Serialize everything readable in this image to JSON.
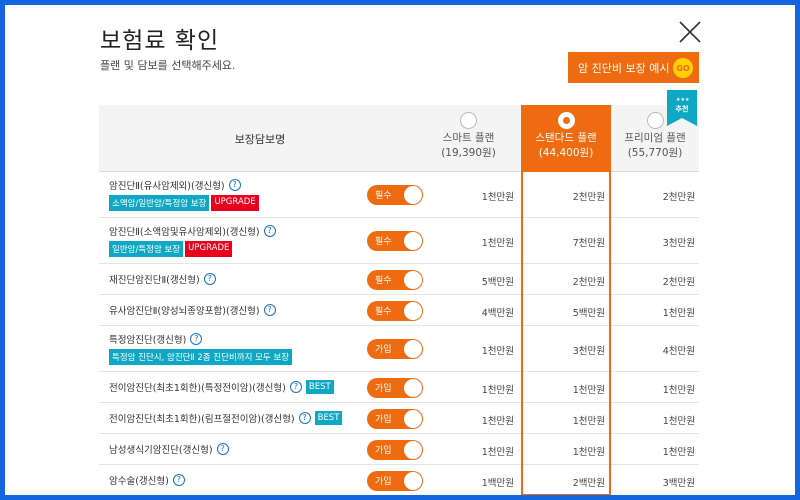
{
  "header": {
    "title": "보험료 확인",
    "subtitle": "플랜 및 담보를 선택해주세요.",
    "promo_label": "암 진단비 보장 예시",
    "promo_go": "GO"
  },
  "table": {
    "name_header": "보장담보명",
    "recommend_badge": "추천",
    "plans": [
      {
        "name": "스마트 플랜",
        "price": "(19,390원)",
        "selected": false
      },
      {
        "name": "스탠다드 플랜",
        "price": "(44,400원)",
        "selected": true
      },
      {
        "name": "프리미엄 플랜",
        "price": "(55,770원)",
        "selected": false
      }
    ],
    "rows": [
      {
        "name": "암진단Ⅱ(유사암제외)(갱신형)",
        "tags": [
          {
            "text": "소액암/일반암/특정암 보장",
            "color": "teal"
          },
          {
            "text": "UPGRADE",
            "color": "red"
          }
        ],
        "best": "",
        "toggle": "필수",
        "amounts": [
          "1천만원",
          "2천만원",
          "2천만원"
        ],
        "height": 46
      },
      {
        "name": "암진단Ⅱ(소액암및유사암제외)(갱신형)",
        "tags": [
          {
            "text": "일반암/특정암 보장",
            "color": "teal"
          },
          {
            "text": "UPGRADE",
            "color": "red"
          }
        ],
        "best": "",
        "toggle": "필수",
        "amounts": [
          "1천만원",
          "7천만원",
          "3천만원"
        ],
        "height": 46
      },
      {
        "name": "재진단암진단Ⅱ(갱신형)",
        "tags": [],
        "best": "",
        "toggle": "필수",
        "amounts": [
          "5백만원",
          "2천만원",
          "2천만원"
        ],
        "height": 31
      },
      {
        "name": "유사암진단Ⅱ(양성뇌종양포함)(갱신형)",
        "tags": [],
        "best": "",
        "toggle": "필수",
        "amounts": [
          "4백만원",
          "5백만원",
          "1천만원"
        ],
        "height": 31
      },
      {
        "name": "특정암진단(갱신형)",
        "tags": [
          {
            "text": "특정암 진단시, 암진단Ⅱ 2종 진단비까지 모두 보장",
            "color": "teal"
          }
        ],
        "best": "",
        "toggle": "가입",
        "amounts": [
          "1천만원",
          "3천만원",
          "4천만원"
        ],
        "height": 46
      },
      {
        "name": "전이암진단(최초1회한)(특정전이암)(갱신형)",
        "tags": [],
        "best": "BEST",
        "toggle": "가입",
        "amounts": [
          "1천만원",
          "1천만원",
          "1천만원"
        ],
        "height": 31
      },
      {
        "name": "전이암진단(최초1회한)(림프절전이암)(갱신형)",
        "tags": [],
        "best": "BEST",
        "toggle": "가입",
        "amounts": [
          "1천만원",
          "1천만원",
          "1천만원"
        ],
        "height": 31
      },
      {
        "name": "남성생식기암진단(갱신형)",
        "tags": [],
        "best": "",
        "toggle": "가입",
        "amounts": [
          "1천만원",
          "1천만원",
          "1천만원"
        ],
        "height": 31
      },
      {
        "name": "암수술(갱신형)",
        "tags": [],
        "best": "",
        "toggle": "가입",
        "amounts": [
          "1백만원",
          "2백만원",
          "3백만원"
        ],
        "height": 31
      }
    ]
  },
  "colors": {
    "accent": "#ee6b12",
    "teal": "#0fa8c4",
    "red": "#e8001c",
    "frame": "#1565e0"
  },
  "icons": {
    "close": "close-icon",
    "help": "help-icon",
    "radio": "radio-icon",
    "ribbon": "recommend-ribbon-icon"
  }
}
